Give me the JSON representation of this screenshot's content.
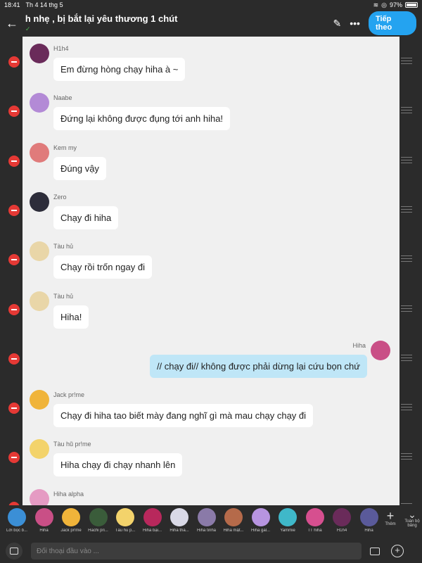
{
  "status_bar": {
    "time": "18:41",
    "date": "Th 4 14 thg 5",
    "battery": "97%"
  },
  "header": {
    "title": "h nhẹ , bị bắt lại yêu thương 1 chút",
    "next_label": "Tiếp theo"
  },
  "messages": [
    {
      "sender": "H1h4",
      "text": "Em đừng hòng chạy hiha à ~",
      "mine": false,
      "avatar_color": "#6a2b5a"
    },
    {
      "sender": "Naabe",
      "text": "Đứng lại không được đụng tới anh hiha!",
      "mine": false,
      "avatar_color": "#b38ad6"
    },
    {
      "sender": "Kem my",
      "text": "Đúng vậy",
      "mine": false,
      "avatar_color": "#e07b7b"
    },
    {
      "sender": "Zero",
      "text": "Chạy đi hiha",
      "mine": false,
      "avatar_color": "#2d2d3a"
    },
    {
      "sender": "Tàu hủ",
      "text": "Chạy rồi trốn ngay đi",
      "mine": false,
      "avatar_color": "#e9d6a8"
    },
    {
      "sender": "Tàu hủ",
      "text": "Hiha!",
      "mine": false,
      "avatar_color": "#e9d6a8"
    },
    {
      "sender": "Hiha",
      "text": "// chạy đi// không được phải dừng lại cứu bọn  chứ",
      "mine": true,
      "avatar_color": "#c94f86"
    },
    {
      "sender": "Jack pr!me",
      "text": "Chạy đi hiha tao biết mày đang nghĩ gì mà mau chạy chạy đi",
      "mine": false,
      "avatar_color": "#f0b43a"
    },
    {
      "sender": "Tàu hũ pr!me",
      "text": "Hiha chạy đi chạy nhanh lên",
      "mine": false,
      "avatar_color": "#f3d36b"
    },
    {
      "sender": "Hiha alpha",
      "text": "",
      "mine": false,
      "avatar_color": "#e59bc3"
    }
  ],
  "members": [
    {
      "name": "Lời bọc b...",
      "color": "#3b8fd6"
    },
    {
      "name": "Hiha",
      "color": "#c94f86"
    },
    {
      "name": "Jack pr!me",
      "color": "#f0b43a"
    },
    {
      "name": "Hachi pri...",
      "color": "#3a5c3a"
    },
    {
      "name": "Tàu hũ p...",
      "color": "#f3d36b"
    },
    {
      "name": "Hiha bại...",
      "color": "#b8285c"
    },
    {
      "name": "Hiha tha...",
      "color": "#d9d9e6"
    },
    {
      "name": "Hiha tinha",
      "color": "#8a7aa8"
    },
    {
      "name": "Hiha mật...",
      "color": "#b56a4a"
    },
    {
      "name": "Hiha gal...",
      "color": "#b794e0"
    },
    {
      "name": "Yammie",
      "color": "#3fb8c9"
    },
    {
      "name": "TT hiha",
      "color": "#d64f8f"
    },
    {
      "name": "H1h4",
      "color": "#6a2b5a"
    },
    {
      "name": "Hiha",
      "color": "#5a5a9a"
    }
  ],
  "add_member_label": "Thêm",
  "fullscreen_label": "Toàn bộ bảng",
  "input": {
    "placeholder": "Đối thoại đầu vào ..."
  }
}
